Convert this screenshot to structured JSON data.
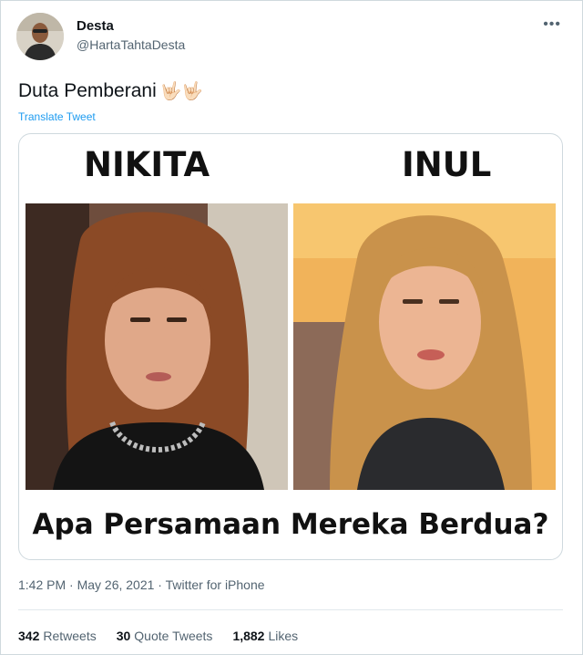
{
  "author": {
    "display_name": "Desta",
    "handle": "@HartaTahtaDesta"
  },
  "menu_icon": "more-horizontal-icon",
  "tweet": {
    "text": "Duta Pemberani",
    "emoji": "🤟🏻🤟🏻",
    "translate_label": "Translate Tweet"
  },
  "image": {
    "left_name": "NIKITA",
    "right_name": "INUL",
    "caption": "Apa Persamaan Mereka Berdua?"
  },
  "meta": {
    "timestamp": "1:42 PM · May 26, 2021 · Twitter for iPhone"
  },
  "stats": {
    "retweets_count": "342",
    "retweets_label": "Retweets",
    "quotes_count": "30",
    "quotes_label": "Quote Tweets",
    "likes_count": "1,882",
    "likes_label": "Likes"
  },
  "colors": {
    "link": "#1d9bf0",
    "muted": "#536471",
    "border": "#cfd9de"
  }
}
